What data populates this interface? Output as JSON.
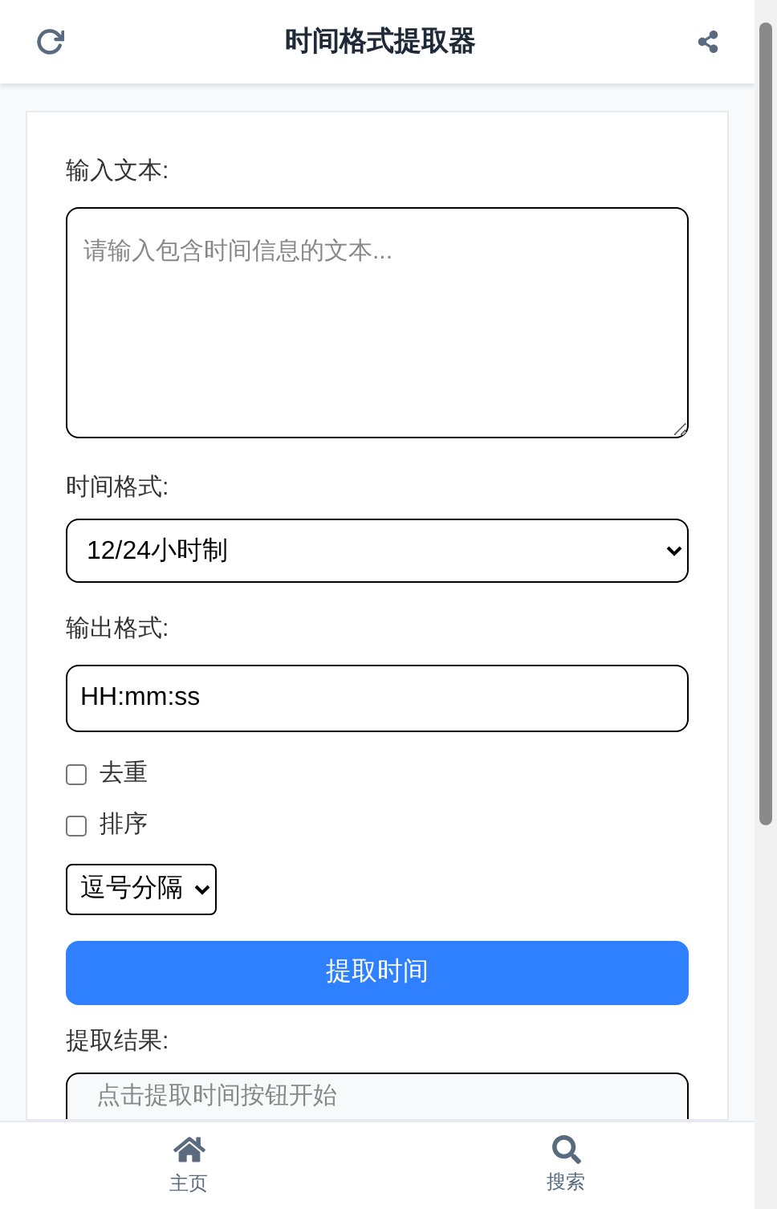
{
  "header": {
    "title": "时间格式提取器"
  },
  "input": {
    "label": "输入文本:",
    "placeholder": "请输入包含时间信息的文本..."
  },
  "time_format": {
    "label": "时间格式:",
    "value": "12/24小时制"
  },
  "output_format": {
    "label": "输出格式:",
    "value": "HH:mm:ss"
  },
  "options": [
    {
      "label": "去重",
      "checked": false
    },
    {
      "label": "排序",
      "checked": false
    }
  ],
  "separator": {
    "value": "逗号分隔"
  },
  "extract_button": "提取时间",
  "result": {
    "label": "提取结果:",
    "placeholder": "点击提取时间按钮开始"
  },
  "nav": [
    {
      "kind": "home",
      "label": "主页",
      "selected": false
    },
    {
      "kind": "search",
      "label": "搜索",
      "selected": false
    }
  ]
}
